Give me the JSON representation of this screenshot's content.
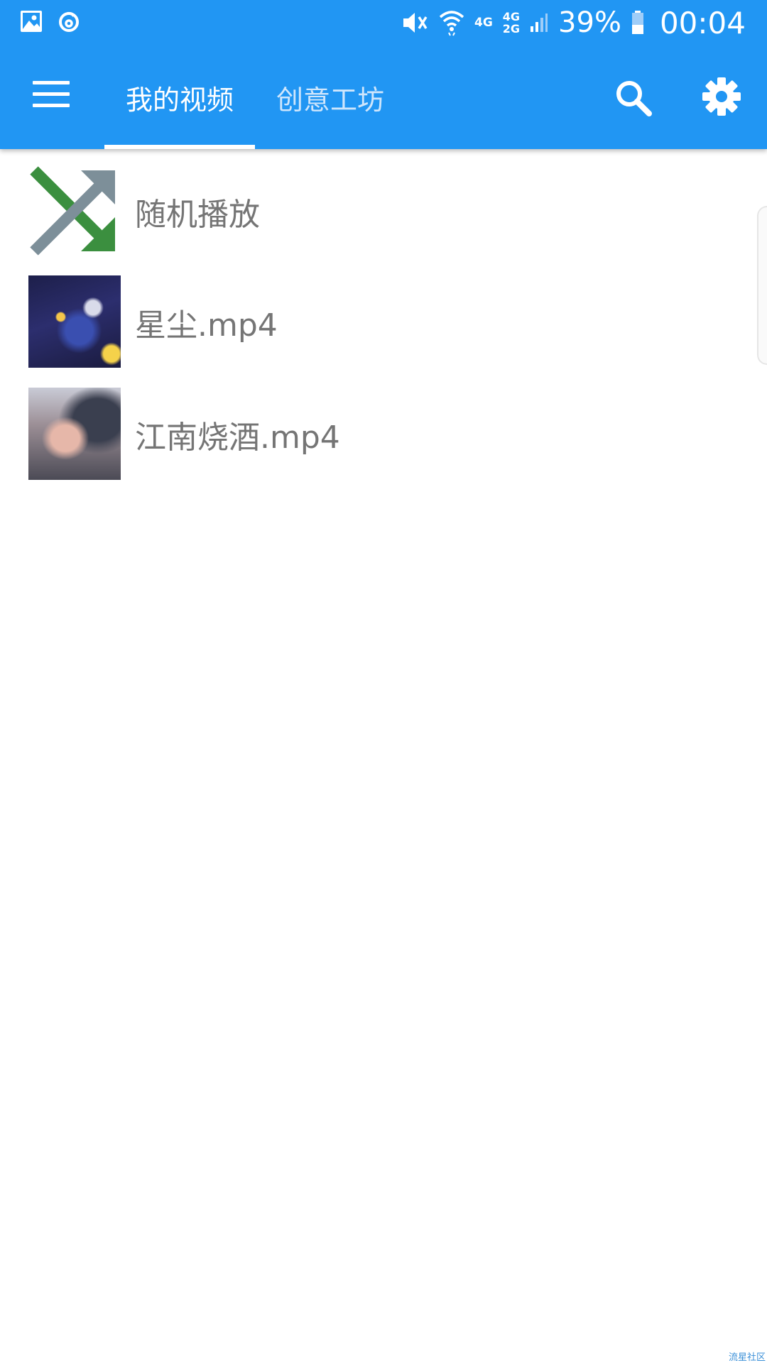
{
  "status_bar": {
    "battery_percent": "39%",
    "time": "00:04",
    "network_4g": "4G",
    "network_dual_top": "4G",
    "network_dual_bottom": "2G"
  },
  "toolbar": {
    "tabs": [
      {
        "label": "我的视频",
        "active": true
      },
      {
        "label": "创意工坊",
        "active": false
      }
    ],
    "accent_color": "#2196f3"
  },
  "list": {
    "items": [
      {
        "label": "随机播放",
        "icon": "shuffle-icon"
      },
      {
        "label": "星尘.mp4",
        "icon": "video-thumbnail"
      },
      {
        "label": "江南烧酒.mp4",
        "icon": "video-thumbnail"
      }
    ]
  },
  "watermark": "流星社区"
}
